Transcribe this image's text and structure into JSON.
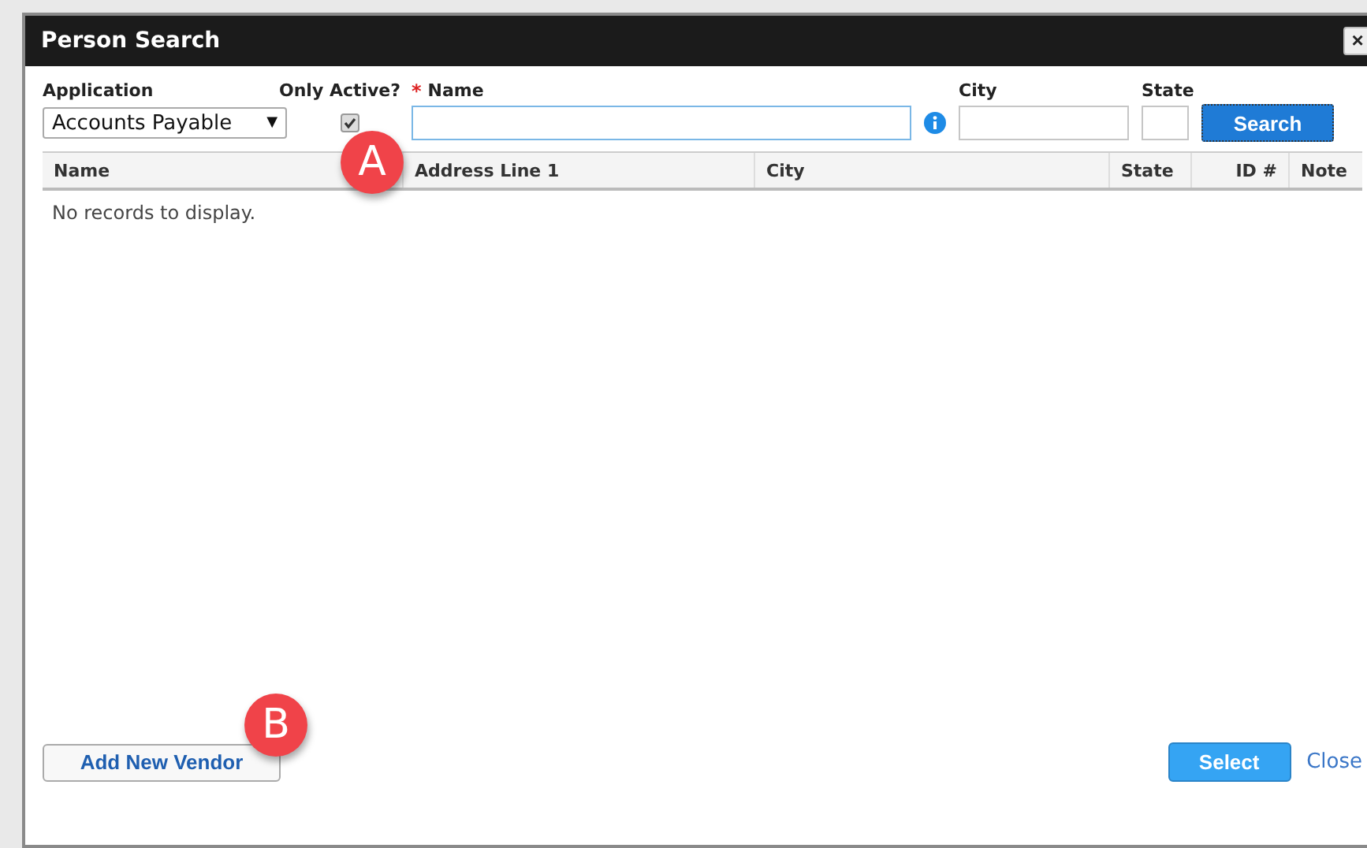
{
  "window": {
    "title": "Person Search",
    "close_label": "×"
  },
  "filters": {
    "application": {
      "label": "Application",
      "value": "Accounts Payable",
      "caret": "▼"
    },
    "only_active": {
      "label": "Only Active?",
      "checked": true
    },
    "name": {
      "label": "Name",
      "required_mark": "*",
      "focused": true
    },
    "city": {
      "label": "City"
    },
    "state": {
      "label": "State"
    },
    "search_button": "Search"
  },
  "table": {
    "columns": [
      "Name",
      "Address Line 1",
      "City",
      "State",
      "ID #",
      "Note"
    ],
    "empty_message": "No records to display."
  },
  "footer": {
    "add_button": "Add New Vendor",
    "select_button": "Select",
    "close_link": "Close"
  },
  "annotations": [
    {
      "label": "A"
    },
    {
      "label": "B"
    }
  ]
}
